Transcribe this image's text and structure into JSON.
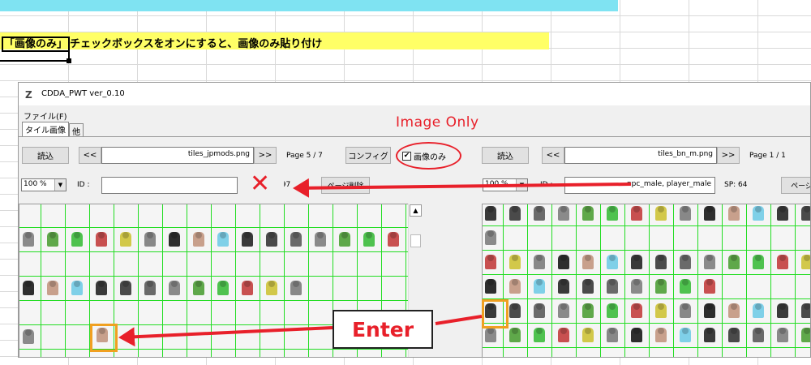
{
  "sheet": {
    "note_bracket": "「画像のみ」",
    "note_rest": "チェックボックスをオンにすると、画像のみ貼り付け"
  },
  "window": {
    "title": "CDDA_PWT  ver_0.10",
    "menu_file": "ファイル(F)",
    "tabs": [
      "タイル画像",
      "他"
    ]
  },
  "left_panel": {
    "load_button": "読込",
    "prev_button": "<<",
    "next_button": ">>",
    "file_name": "tiles_jpmods.png",
    "page_label": "Page 5 / 7",
    "zoom": "100 %",
    "id_label": "ID :",
    "id_value": "",
    "sp_fragment": "597",
    "delete_page_button": "ページ削除"
  },
  "config_button": "コンフィグ",
  "image_only_checkbox": {
    "label": "画像のみ",
    "checked": true,
    "mark": "✔"
  },
  "right_panel": {
    "load_button": "読込",
    "prev_button": "<<",
    "next_button": ">>",
    "file_name": "tiles_bn_m.png",
    "page_label": "Page 1 / 1",
    "zoom": "100 %",
    "id_label": "ID :",
    "id_value": "npc_male,  player_male",
    "sp_label": "SP: 64",
    "delete_page_button": "ページ削"
  },
  "annotations": {
    "image_only": "Image Only",
    "x_mark": "✕",
    "enter": "Enter",
    "color": "#e8202a",
    "highlight": "#f0a020"
  },
  "icons": {
    "scroll_up": "▲",
    "dropdown": "▼"
  }
}
